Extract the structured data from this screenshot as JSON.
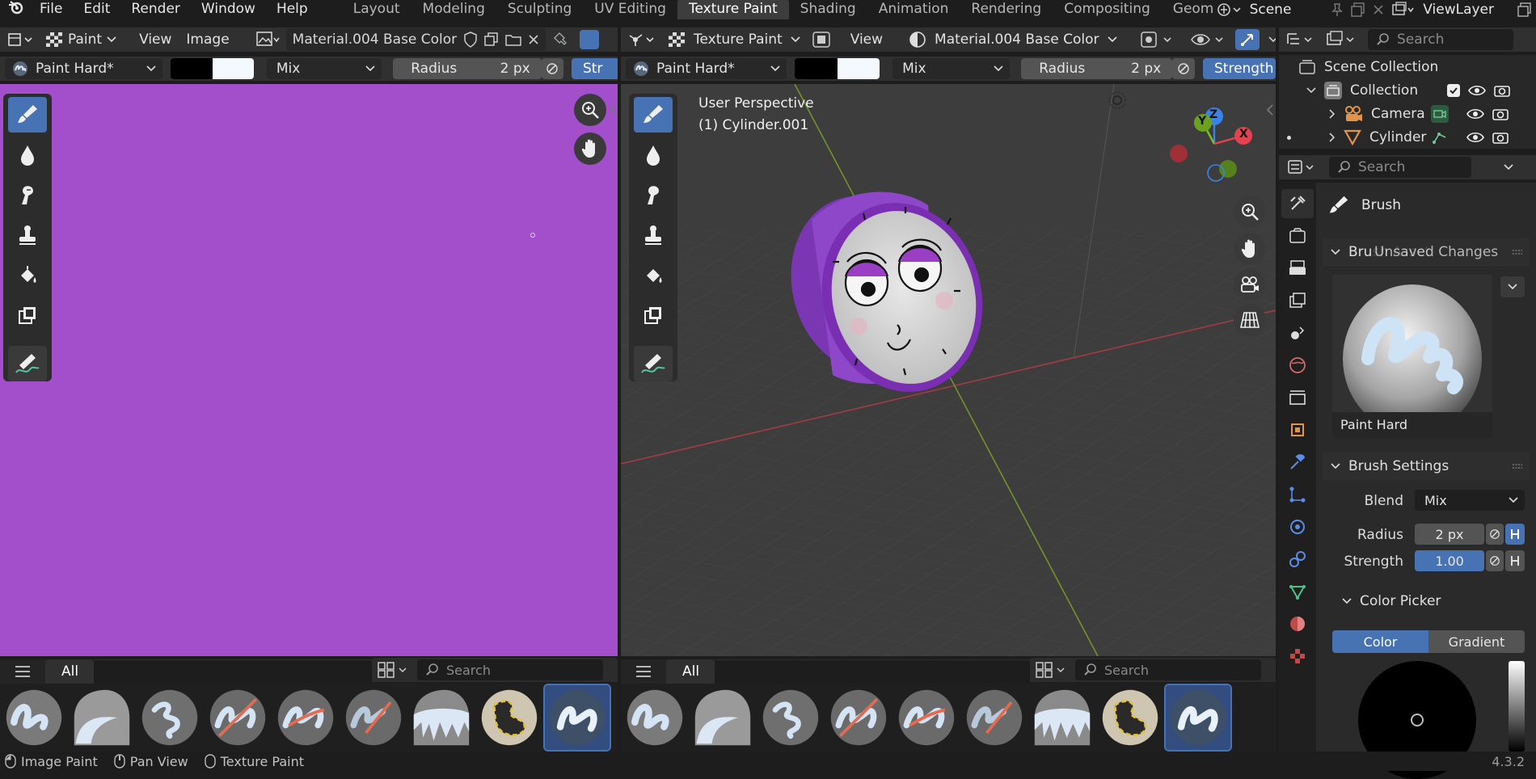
{
  "menubar": {
    "menus": [
      "File",
      "Edit",
      "Render",
      "Window",
      "Help"
    ],
    "workspaces": [
      "Layout",
      "Modeling",
      "Sculpting",
      "UV Editing",
      "Texture Paint",
      "Shading",
      "Animation",
      "Rendering",
      "Compositing",
      "Geomet"
    ],
    "scene_name": "Scene",
    "view_layer": "ViewLayer"
  },
  "image_editor": {
    "mode": "Paint",
    "menus": [
      "View",
      "Image"
    ],
    "image_name": "Material.004 Base Color",
    "brush": "Paint Hard*",
    "blend": "Mix",
    "radius_label": "Radius",
    "radius_value": "2 px",
    "strength_label": "Str",
    "canvas_color": "#a34fcc"
  },
  "viewport": {
    "mode": "Texture Paint",
    "menu_view": "View",
    "material_slot": "Material.004 Base Color",
    "brush": "Paint Hard*",
    "blend": "Mix",
    "radius_label": "Radius",
    "radius_value": "2 px",
    "strength_label": "Strength",
    "overlay_title": "User Perspective",
    "overlay_object": "(1) Cylinder.001",
    "gizmo": {
      "x": "X",
      "y": "Y",
      "z": "Z"
    }
  },
  "asset_shelf": {
    "filter_tab": "All",
    "search_placeholder": "Search",
    "brush_count": 9,
    "selected_index": 8
  },
  "outliner": {
    "search_placeholder": "Search",
    "items": [
      {
        "label": "Scene Collection",
        "level": 0
      },
      {
        "label": "Collection",
        "level": 1
      },
      {
        "label": "Camera",
        "level": 2
      },
      {
        "label": "Cylinder",
        "level": 2
      }
    ]
  },
  "properties": {
    "search_placeholder": "Search",
    "context_title": "Brush",
    "brush_asset_panel": "Brush Asset",
    "unsaved_overlay": "Unsaved Changes",
    "brush_name": "Paint Hard",
    "settings_panel": "Brush Settings",
    "blend_label": "Blend",
    "blend_value": "Mix",
    "radius_label": "Radius",
    "radius_value": "2 px",
    "strength_label": "Strength",
    "strength_value": "1.00",
    "strength_fraction": 1.0,
    "color_picker_panel": "Color Picker",
    "color_tab": "Color",
    "gradient_tab": "Gradient",
    "picker_value": "#000000"
  },
  "statusbar": {
    "items": [
      "Image Paint",
      "Pan View",
      "Texture Paint"
    ],
    "version": "4.3.2"
  },
  "colors": {
    "accent": "#4772b3",
    "primary_color": "#000000",
    "secondary_color": "#f4f8ff",
    "mesh_purple": "#8e47c9",
    "axis_x": "#e2434f",
    "axis_y": "#7fbf26",
    "axis_z": "#3b83e6"
  }
}
